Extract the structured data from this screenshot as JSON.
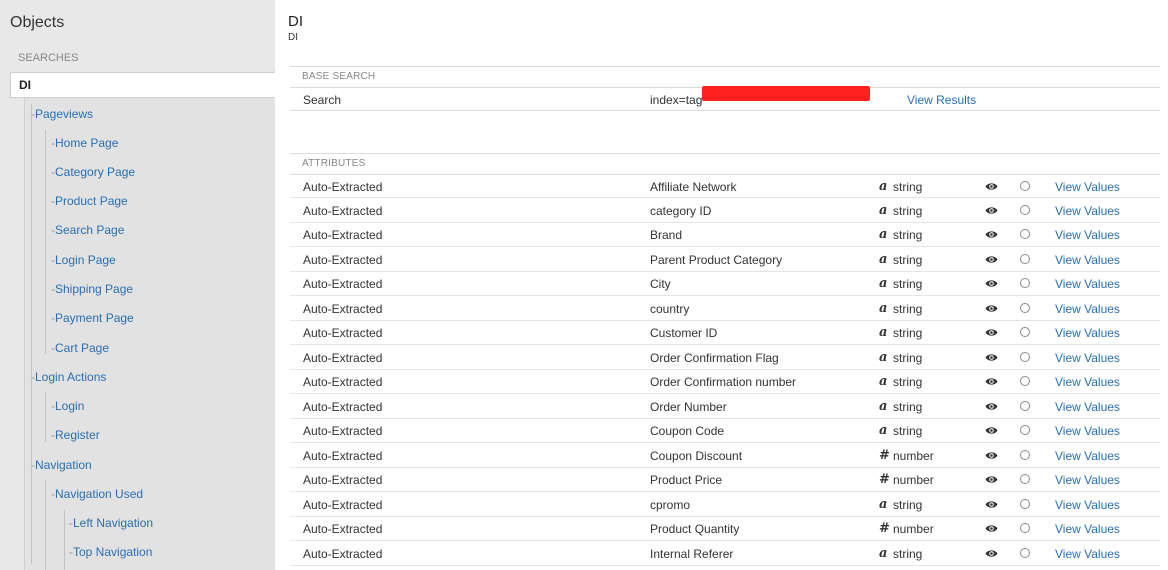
{
  "sidebar": {
    "title": "Objects",
    "section_label": "SEARCHES",
    "selected": "DI",
    "tree": [
      {
        "label": "Pageviews"
      },
      {
        "label": "Home Page"
      },
      {
        "label": "Category Page"
      },
      {
        "label": "Product Page"
      },
      {
        "label": "Search Page"
      },
      {
        "label": "Login Page"
      },
      {
        "label": "Shipping Page"
      },
      {
        "label": "Payment Page"
      },
      {
        "label": "Cart Page"
      },
      {
        "label": "Login Actions"
      },
      {
        "label": "Login"
      },
      {
        "label": "Register"
      },
      {
        "label": "Navigation"
      },
      {
        "label": "Navigation Used"
      },
      {
        "label": "Left Navigation"
      },
      {
        "label": "Top Navigation"
      }
    ]
  },
  "main": {
    "title": "DI",
    "subtitle": "DI",
    "base_search": {
      "label": "BASE SEARCH",
      "row_label": "Search",
      "query_visible": "index=tag",
      "redaction_color": "#ff2020",
      "link": "View Results"
    },
    "attributes": {
      "label": "ATTRIBUTES",
      "rows": [
        {
          "source": "Auto-Extracted",
          "name": "Affiliate Network",
          "type_icon": "a",
          "type": "string",
          "link": "View Values"
        },
        {
          "source": "Auto-Extracted",
          "name": "category ID",
          "type_icon": "a",
          "type": "string",
          "link": "View Values"
        },
        {
          "source": "Auto-Extracted",
          "name": "Brand",
          "type_icon": "a",
          "type": "string",
          "link": "View Values"
        },
        {
          "source": "Auto-Extracted",
          "name": "Parent Product Category",
          "type_icon": "a",
          "type": "string",
          "link": "View Values"
        },
        {
          "source": "Auto-Extracted",
          "name": "City",
          "type_icon": "a",
          "type": "string",
          "link": "View Values"
        },
        {
          "source": "Auto-Extracted",
          "name": "country",
          "type_icon": "a",
          "type": "string",
          "link": "View Values"
        },
        {
          "source": "Auto-Extracted",
          "name": "Customer ID",
          "type_icon": "a",
          "type": "string",
          "link": "View Values"
        },
        {
          "source": "Auto-Extracted",
          "name": "Order Confirmation Flag",
          "type_icon": "a",
          "type": "string",
          "link": "View Values"
        },
        {
          "source": "Auto-Extracted",
          "name": "Order Confirmation number",
          "type_icon": "a",
          "type": "string",
          "link": "View Values"
        },
        {
          "source": "Auto-Extracted",
          "name": "Order Number",
          "type_icon": "a",
          "type": "string",
          "link": "View Values"
        },
        {
          "source": "Auto-Extracted",
          "name": "Coupon Code",
          "type_icon": "a",
          "type": "string",
          "link": "View Values"
        },
        {
          "source": "Auto-Extracted",
          "name": "Coupon Discount",
          "type_icon": "#",
          "type": "number",
          "link": "View Values"
        },
        {
          "source": "Auto-Extracted",
          "name": "Product Price",
          "type_icon": "#",
          "type": "number",
          "link": "View Values"
        },
        {
          "source": "Auto-Extracted",
          "name": "cpromo",
          "type_icon": "a",
          "type": "string",
          "link": "View Values"
        },
        {
          "source": "Auto-Extracted",
          "name": "Product Quantity",
          "type_icon": "#",
          "type": "number",
          "link": "View Values"
        },
        {
          "source": "Auto-Extracted",
          "name": "Internal Referer",
          "type_icon": "a",
          "type": "string",
          "link": "View Values"
        }
      ]
    }
  },
  "colors": {
    "link": "#2a6fb3",
    "sidebar_bg": "#e8e8e8",
    "muted_label": "#888888"
  }
}
